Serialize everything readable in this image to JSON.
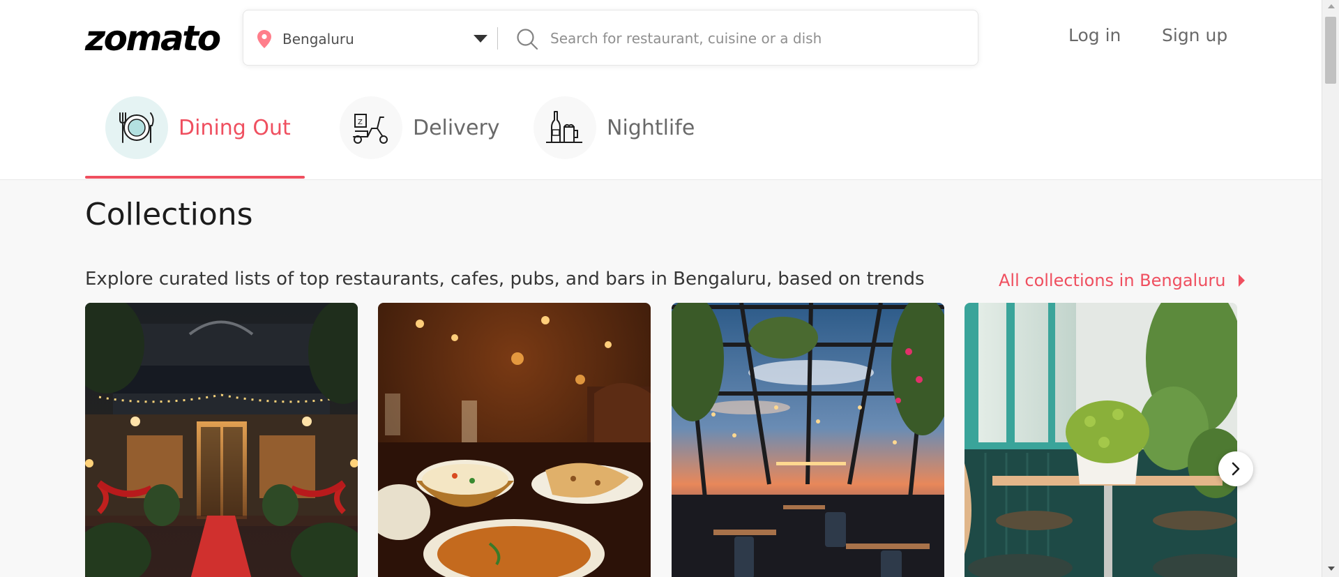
{
  "header": {
    "logo_text": "zomato",
    "location": "Bengaluru",
    "search_placeholder": "Search for restaurant, cuisine or a dish",
    "login_label": "Log in",
    "signup_label": "Sign up"
  },
  "tabs": [
    {
      "label": "Dining Out",
      "icon": "dining-icon",
      "active": true
    },
    {
      "label": "Delivery",
      "icon": "scooter-icon",
      "active": false
    },
    {
      "label": "Nightlife",
      "icon": "bottle-mug-icon",
      "active": false
    }
  ],
  "collections": {
    "title": "Collections",
    "subtitle": "Explore curated lists of top restaurants, cafes, pubs, and bars in Bengaluru, based on trends",
    "link_label": "All collections in Bengaluru",
    "cards": [
      {
        "image": "restaurant-entrance-red-carpet"
      },
      {
        "image": "indian-food-table"
      },
      {
        "image": "rooftop-dining-sunset"
      },
      {
        "image": "cafe-table-plant"
      }
    ]
  },
  "colors": {
    "brand": "#ef4f5f",
    "active_circle": "#e5f3f3",
    "muted_text": "#696969"
  },
  "icons": {
    "location": "location-pin-icon",
    "dropdown": "caret-down-icon",
    "search": "search-icon",
    "next": "chevron-right-icon"
  }
}
